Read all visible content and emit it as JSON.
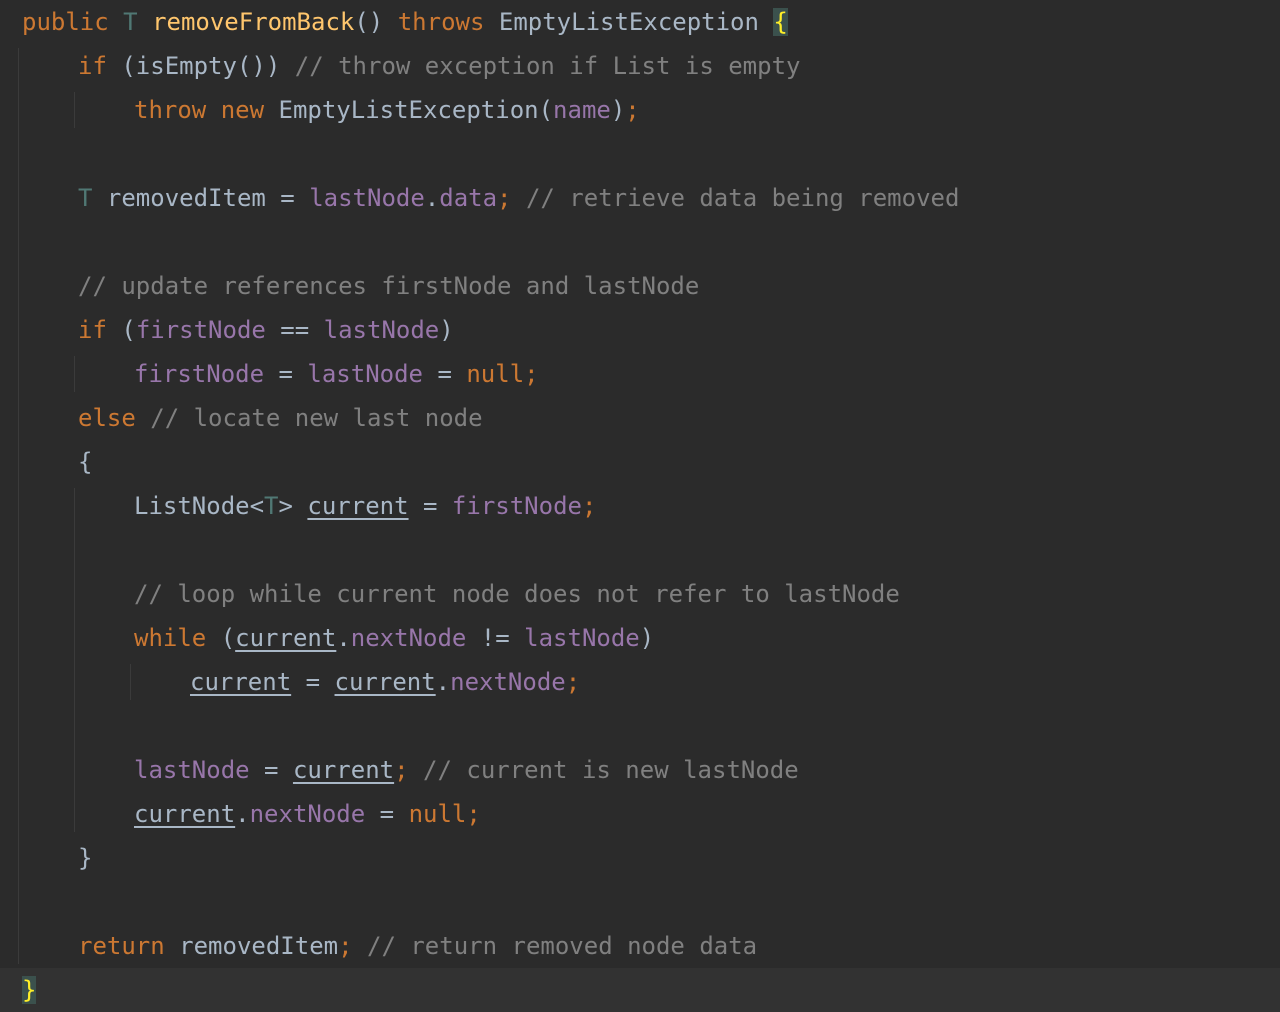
{
  "editor": {
    "language": "Java",
    "theme": "dark",
    "colors": {
      "background": "#2b2b2b",
      "keyword": "#cc7832",
      "field": "#9876aa",
      "comment": "#808080",
      "method": "#ffc66d",
      "plain": "#a9b7c6",
      "brace_match": "#ffef28"
    },
    "lines": [
      {
        "tokens": [
          {
            "t": "public",
            "k": "kw"
          },
          {
            "t": " "
          },
          {
            "t": "T",
            "k": "tp"
          },
          {
            "t": " "
          },
          {
            "t": "removeFromBack",
            "k": "mth"
          },
          {
            "t": "() "
          },
          {
            "t": "throws",
            "k": "kw"
          },
          {
            "t": " EmptyListException "
          },
          {
            "t": "{",
            "k": "brace-hl"
          }
        ]
      },
      {
        "indent": 1,
        "tokens": [
          {
            "t": "if",
            "k": "kw"
          },
          {
            "t": " (isEmpty()) "
          },
          {
            "t": "// throw exception if List is empty",
            "k": "cmt"
          }
        ]
      },
      {
        "indent": 2,
        "tokens": [
          {
            "t": "throw",
            "k": "kw"
          },
          {
            "t": " "
          },
          {
            "t": "new",
            "k": "kw"
          },
          {
            "t": " EmptyListException("
          },
          {
            "t": "name",
            "k": "fnd"
          },
          {
            "t": ")"
          },
          {
            "t": ";",
            "k": "kw"
          }
        ]
      },
      {
        "tokens": []
      },
      {
        "indent": 1,
        "tokens": [
          {
            "t": "T",
            "k": "tp"
          },
          {
            "t": " removedItem = "
          },
          {
            "t": "lastNode",
            "k": "fnd"
          },
          {
            "t": "."
          },
          {
            "t": "data",
            "k": "fnd"
          },
          {
            "t": ";",
            "k": "kw"
          },
          {
            "t": " "
          },
          {
            "t": "// retrieve data being removed",
            "k": "cmt"
          }
        ]
      },
      {
        "tokens": []
      },
      {
        "indent": 1,
        "tokens": [
          {
            "t": "// update references firstNode and lastNode",
            "k": "cmt"
          }
        ]
      },
      {
        "indent": 1,
        "tokens": [
          {
            "t": "if",
            "k": "kw"
          },
          {
            "t": " ("
          },
          {
            "t": "firstNode",
            "k": "fnd"
          },
          {
            "t": " == "
          },
          {
            "t": "lastNode",
            "k": "fnd"
          },
          {
            "t": ")"
          }
        ]
      },
      {
        "indent": 2,
        "tokens": [
          {
            "t": "firstNode",
            "k": "fnd"
          },
          {
            "t": " = "
          },
          {
            "t": "lastNode",
            "k": "fnd"
          },
          {
            "t": " = "
          },
          {
            "t": "null",
            "k": "kw"
          },
          {
            "t": ";",
            "k": "kw"
          }
        ]
      },
      {
        "indent": 1,
        "tokens": [
          {
            "t": "else",
            "k": "kw"
          },
          {
            "t": " "
          },
          {
            "t": "// locate new last node",
            "k": "cmt"
          }
        ]
      },
      {
        "indent": 1,
        "tokens": [
          {
            "t": "{"
          }
        ]
      },
      {
        "indent": 2,
        "tokens": [
          {
            "t": "ListNode<"
          },
          {
            "t": "T",
            "k": "tp"
          },
          {
            "t": "> "
          },
          {
            "t": "current",
            "k": "var"
          },
          {
            "t": " = "
          },
          {
            "t": "firstNode",
            "k": "fnd"
          },
          {
            "t": ";",
            "k": "kw"
          }
        ]
      },
      {
        "tokens": []
      },
      {
        "indent": 2,
        "tokens": [
          {
            "t": "// loop while current node does not refer to lastNode",
            "k": "cmt"
          }
        ]
      },
      {
        "indent": 2,
        "tokens": [
          {
            "t": "while",
            "k": "kw"
          },
          {
            "t": " ("
          },
          {
            "t": "current",
            "k": "var"
          },
          {
            "t": "."
          },
          {
            "t": "nextNode",
            "k": "fnd"
          },
          {
            "t": " != "
          },
          {
            "t": "lastNode",
            "k": "fnd"
          },
          {
            "t": ")"
          }
        ]
      },
      {
        "indent": 3,
        "tokens": [
          {
            "t": "current",
            "k": "var"
          },
          {
            "t": " = "
          },
          {
            "t": "current",
            "k": "var"
          },
          {
            "t": "."
          },
          {
            "t": "nextNode",
            "k": "fnd"
          },
          {
            "t": ";",
            "k": "kw"
          }
        ]
      },
      {
        "tokens": []
      },
      {
        "indent": 2,
        "tokens": [
          {
            "t": "lastNode",
            "k": "fnd"
          },
          {
            "t": " = "
          },
          {
            "t": "current",
            "k": "var"
          },
          {
            "t": ";",
            "k": "kw"
          },
          {
            "t": " "
          },
          {
            "t": "// current is new lastNode",
            "k": "cmt"
          }
        ]
      },
      {
        "indent": 2,
        "tokens": [
          {
            "t": "current",
            "k": "var"
          },
          {
            "t": "."
          },
          {
            "t": "nextNode",
            "k": "fnd"
          },
          {
            "t": " = "
          },
          {
            "t": "null",
            "k": "kw"
          },
          {
            "t": ";",
            "k": "kw"
          }
        ]
      },
      {
        "indent": 1,
        "tokens": [
          {
            "t": "}"
          }
        ]
      },
      {
        "tokens": []
      },
      {
        "indent": 1,
        "tokens": [
          {
            "t": "return",
            "k": "kw"
          },
          {
            "t": " removedItem"
          },
          {
            "t": ";",
            "k": "kw"
          },
          {
            "t": " "
          },
          {
            "t": "// return removed node data",
            "k": "cmt"
          }
        ]
      },
      {
        "caret": true,
        "tokens": [
          {
            "t": "}",
            "k": "brace-hl2"
          }
        ]
      }
    ]
  }
}
